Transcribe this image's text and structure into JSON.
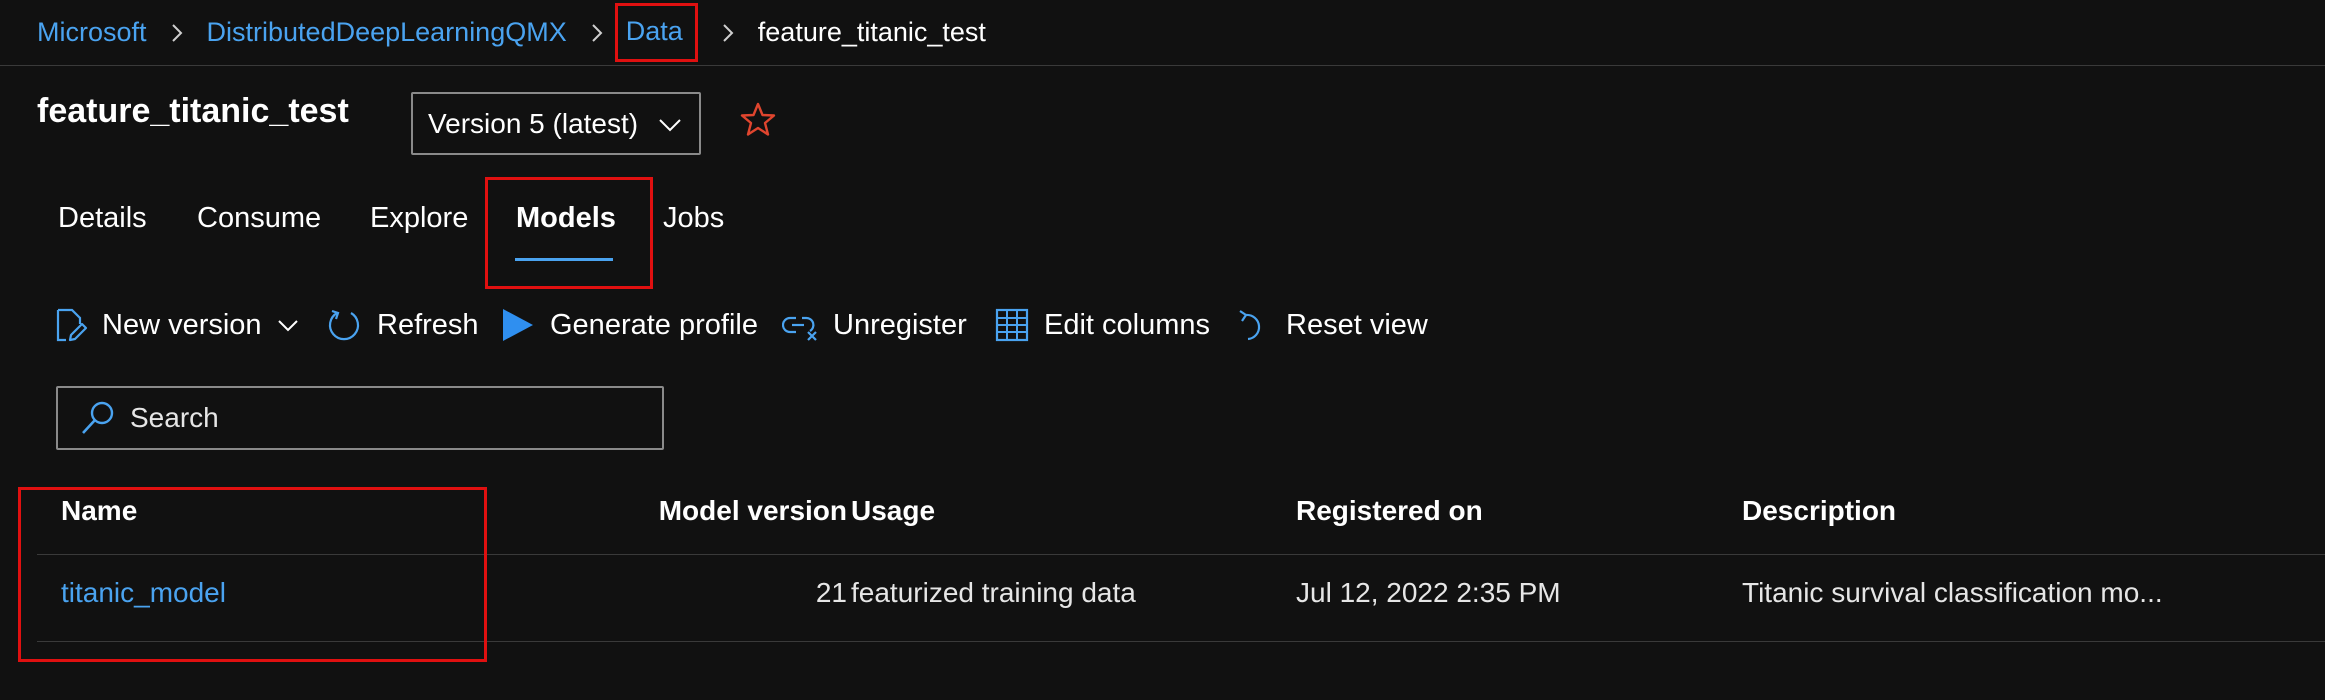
{
  "breadcrumb": {
    "items": [
      "Microsoft",
      "DistributedDeepLearningQMX",
      "Data"
    ],
    "current": "feature_titanic_test"
  },
  "asset": {
    "title": "feature_titanic_test",
    "version_selected": "Version 5 (latest)"
  },
  "tabs": [
    {
      "label": "Details"
    },
    {
      "label": "Consume"
    },
    {
      "label": "Explore"
    },
    {
      "label": "Models"
    },
    {
      "label": "Jobs"
    }
  ],
  "active_tab": "Models",
  "toolbar": {
    "new_version": "New version",
    "refresh": "Refresh",
    "generate_profile": "Generate profile",
    "unregister": "Unregister",
    "edit_columns": "Edit columns",
    "reset_view": "Reset view"
  },
  "search": {
    "placeholder": "Search",
    "value": ""
  },
  "table": {
    "columns": [
      "Name",
      "Model version",
      "Usage",
      "Registered on",
      "Description"
    ],
    "rows": [
      {
        "name": "titanic_model",
        "model_version": "21",
        "usage": "featurized training data",
        "registered_on": "Jul 12, 2022 2:35 PM",
        "description": "Titanic survival classification mo..."
      }
    ]
  },
  "colors": {
    "background": "#111111",
    "link": "#4aa3f0",
    "highlight": "#e01010",
    "accent_star": "#e0452e"
  },
  "icons": {
    "breadcrumb_sep": "chevron-right-icon",
    "version_dropdown": "chevron-down-icon",
    "favorite": "star-outline-icon",
    "new_version": "edit-document-icon",
    "refresh": "refresh-icon",
    "generate_profile": "play-icon",
    "unregister": "unlink-icon",
    "edit_columns": "table-columns-icon",
    "reset_view": "undo-icon",
    "search": "search-icon"
  }
}
